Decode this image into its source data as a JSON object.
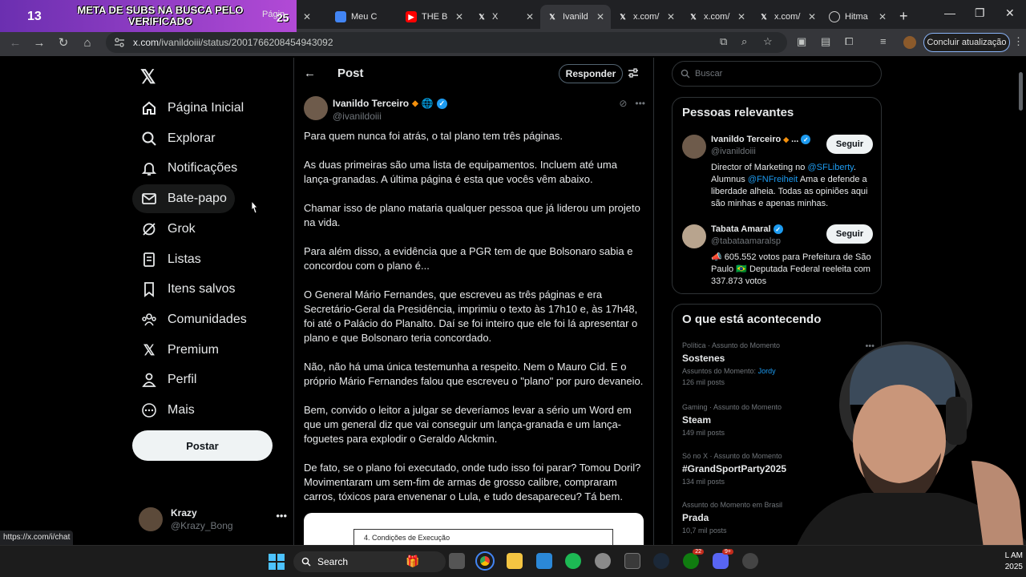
{
  "browser": {
    "tabs": [
      {
        "label": "Págin",
        "fav_color": "#5f6368"
      },
      {
        "label": "Meu C",
        "fav_color": "#4285f4"
      },
      {
        "label": "THE B",
        "fav_color": "#ff0000"
      },
      {
        "label": "X",
        "fav_color": "#000000"
      },
      {
        "label": "Ivanild",
        "fav_color": "#000000",
        "active": true
      },
      {
        "label": "x.com/",
        "fav_color": "#000000"
      },
      {
        "label": "x.com/",
        "fav_color": "#000000"
      },
      {
        "label": "x.com/",
        "fav_color": "#000000"
      },
      {
        "label": "Hitma",
        "fav_color": "#3a3a3a"
      }
    ],
    "close_glyph": "✕",
    "new_tab_glyph": "+",
    "url_domain": "x.com",
    "url_path": "/ivanildoiii/status/2001766208454943092",
    "update_button": "Concluir atualização",
    "status_url": "https://x.com/i/chat"
  },
  "stream_overlay": {
    "left_number": "13",
    "banner_text": "META DE SUBS NA BUSCA PELO VERIFICADO",
    "right_number": "25"
  },
  "nav": {
    "items": [
      {
        "label": "Página Inicial",
        "icon": "home-icon"
      },
      {
        "label": "Explorar",
        "icon": "search-icon"
      },
      {
        "label": "Notificações",
        "icon": "bell-icon"
      },
      {
        "label": "Bate-papo",
        "icon": "mail-icon"
      },
      {
        "label": "Grok",
        "icon": "grok-icon"
      },
      {
        "label": "Listas",
        "icon": "list-icon"
      },
      {
        "label": "Itens salvos",
        "icon": "bookmark-icon"
      },
      {
        "label": "Comunidades",
        "icon": "communities-icon"
      },
      {
        "label": "Premium",
        "icon": "x-premium-icon"
      },
      {
        "label": "Perfil",
        "icon": "profile-icon"
      },
      {
        "label": "Mais",
        "icon": "more-icon"
      }
    ],
    "post_button": "Postar",
    "account": {
      "name": "Krazy",
      "handle": "@Krazy_Bong"
    }
  },
  "post": {
    "header_title": "Post",
    "reply_button": "Responder",
    "author_name": "Ivanildo Terceiro",
    "author_handle": "@ivanildoiii",
    "paragraphs": [
      "Para quem nunca foi atrás, o tal plano tem três páginas.",
      "As duas primeiras são uma lista de equipamentos. Incluem até uma lança-granadas. A última página é esta que vocês vêm abaixo.",
      "Chamar isso de plano mataria qualquer pessoa que já liderou um projeto na vida.",
      "Para além disso, a evidência que a PGR tem de que Bolsonaro sabia e concordou com o plano é...",
      "O General Mário Fernandes, que escreveu as três páginas e era Secretário-Geral da Presidência, imprimiu o texto às 17h10 e, às 17h48, foi até o Palácio do Planalto. Daí se foi inteiro que ele foi lá apresentar o plano e que Bolsonaro teria concordado.",
      "Não, não há uma única testemunha a respeito. Nem o Mauro Cid. E o próprio Mário Fernandes falou que escreveu o \"plano\" por puro devaneio.",
      "Bem, convido o leitor a julgar se deveríamos levar a sério um Word em que um general diz que vai conseguir um lança-granada e um lança-foguetes para explodir o Geraldo Alckmin.",
      "De fato, se o plano foi executado, onde tudo isso foi parar? Tomou Doril? Movimentaram um sem-fim de armas de grosso calibre, compraram carros, tóxicos para envenenar o Lula, e tudo desapareceu? Tá bem."
    ],
    "image_caption": "4. Condições de Execução"
  },
  "sidebar": {
    "search_placeholder": "Buscar",
    "relevant_title": "Pessoas relevantes",
    "people": [
      {
        "name": "Ivanildo Terceiro",
        "name_suffix": "...",
        "handle": "@ivanildoiii",
        "follow": "Seguir",
        "bio_1": "Director of Marketing no ",
        "bio_link_1": "@SFLiberty",
        "bio_2": ". Alumnus ",
        "bio_link_2": "@FNFreiheit",
        "bio_3": " Ama e defende a liberdade alheia. Todas as opiniões aqui são minhas e apenas minhas."
      },
      {
        "name": "Tabata Amaral",
        "handle": "@tabataamaralsp",
        "follow": "Seguir",
        "bio": "📣 605.552 votos para Prefeitura de São Paulo 🇧🇷 Deputada Federal reeleita com 337.873 votos"
      }
    ],
    "trending_title": "O que está acontecendo",
    "trends": [
      {
        "meta": "Política · Assunto do Momento",
        "name": "Sostenes",
        "sub_prefix": "Assuntos do Momento: ",
        "sub_link": "Jordy",
        "count": "126 mil posts"
      },
      {
        "meta": "Gaming · Assunto do Momento",
        "name": "Steam",
        "count": "149 mil posts"
      },
      {
        "meta": "Só no X · Assunto do Momento",
        "name": "#GrandSportParty2025",
        "count": "134 mil posts"
      },
      {
        "meta": "Assunto do Momento em Brasil",
        "name": "Prada",
        "count": "10,7 mil posts"
      }
    ]
  },
  "taskbar": {
    "search_label": "Search",
    "clock_time": "L AM",
    "clock_year": "2025",
    "badge_1": "22",
    "badge_2": "9+"
  }
}
